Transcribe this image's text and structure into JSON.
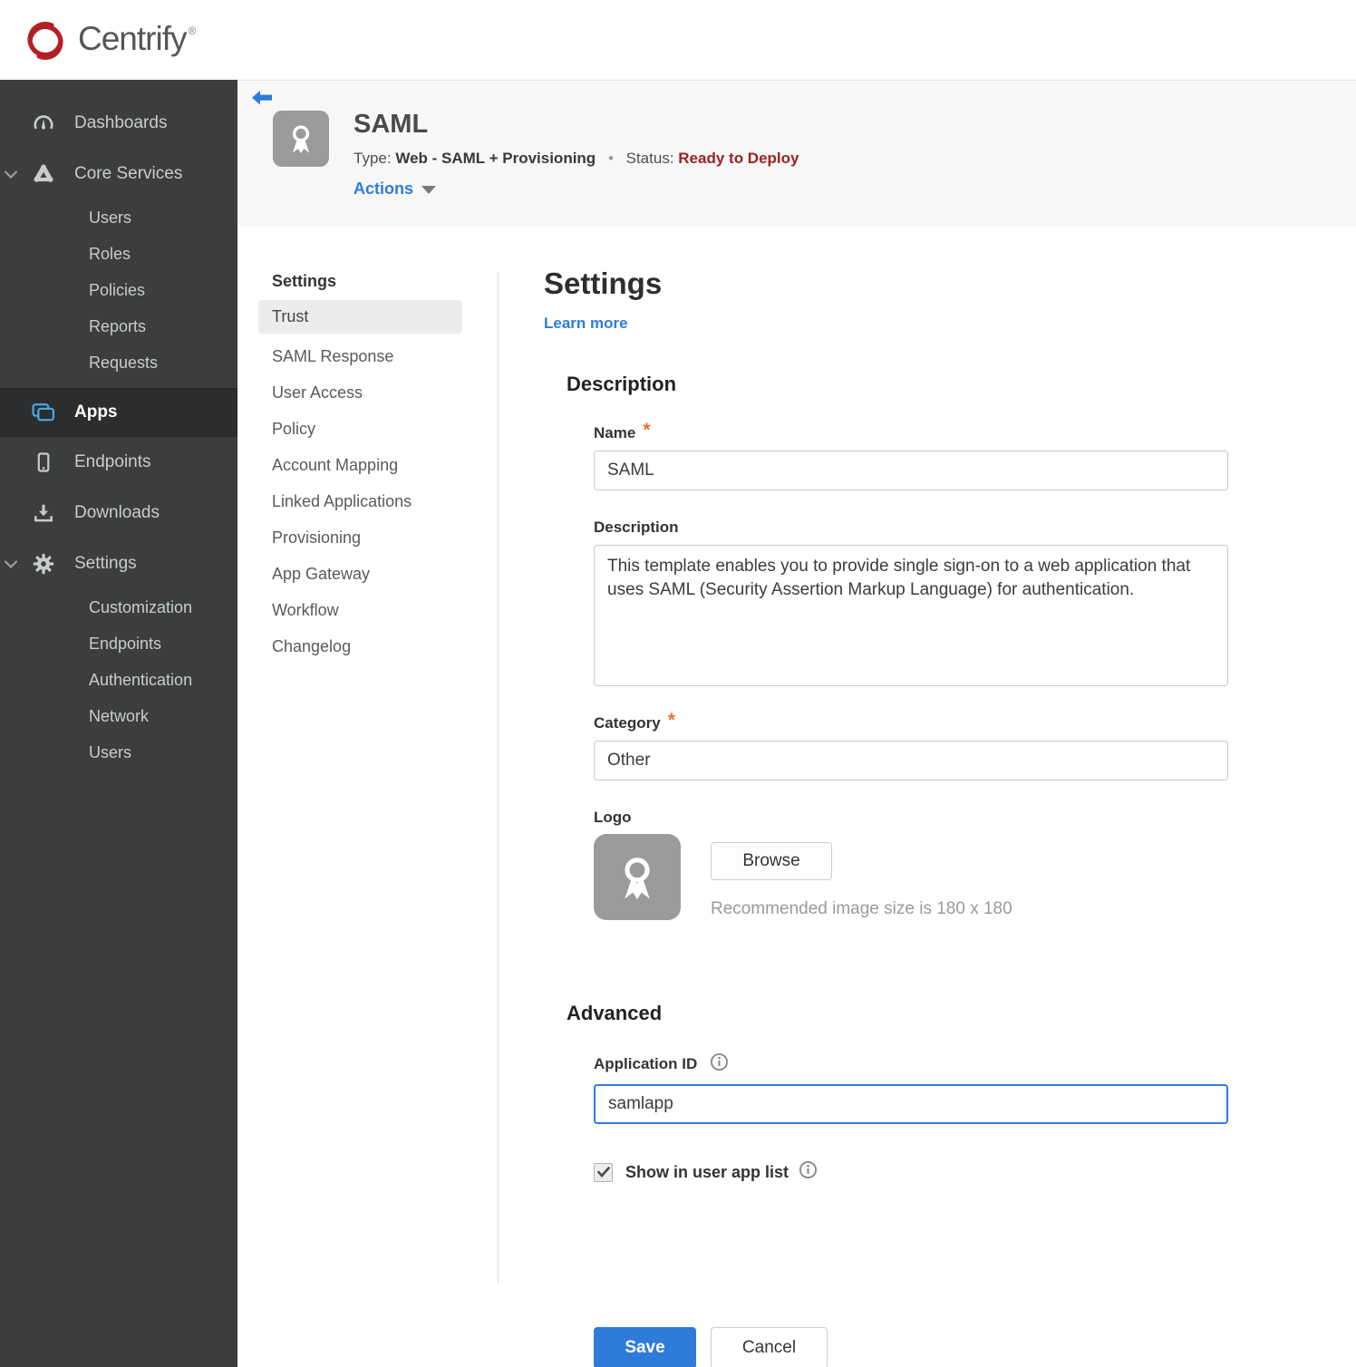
{
  "colors": {
    "accent_blue": "#2f7bda",
    "status_red": "#9e2023",
    "required_orange": "#e8762d",
    "sidebar_icon_blue": "#4aa3e0",
    "brand_red": "#b32025",
    "sidebar_bg": "#3b3d3e"
  },
  "brand": {
    "name": "Centrify",
    "trademark": "®"
  },
  "sidebar": {
    "dashboards": "Dashboards",
    "core_services": "Core Services",
    "core_children": [
      "Users",
      "Roles",
      "Policies",
      "Reports",
      "Requests"
    ],
    "apps": "Apps",
    "endpoints": "Endpoints",
    "downloads": "Downloads",
    "settings": "Settings",
    "settings_children": [
      "Customization",
      "Endpoints",
      "Authentication",
      "Network",
      "Users"
    ]
  },
  "app_header": {
    "title": "SAML",
    "type_label": "Type:",
    "type_value": "Web - SAML + Provisioning",
    "separator": "•",
    "status_label": "Status:",
    "status_value": "Ready to Deploy",
    "actions_label": "Actions"
  },
  "subnav": {
    "title": "Settings",
    "items": [
      {
        "label": "Trust",
        "active": true
      },
      {
        "label": "SAML Response"
      },
      {
        "label": "User Access"
      },
      {
        "label": "Policy"
      },
      {
        "label": "Account Mapping"
      },
      {
        "label": "Linked Applications"
      },
      {
        "label": "Provisioning"
      },
      {
        "label": "App Gateway"
      },
      {
        "label": "Workflow"
      },
      {
        "label": "Changelog"
      }
    ]
  },
  "main": {
    "title": "Settings",
    "learn_more": "Learn more",
    "description": {
      "heading": "Description",
      "name_label": "Name",
      "required_marker": "*",
      "name_value": "SAML",
      "description_label": "Description",
      "description_value": "This template enables you to provide single sign-on to a web application that uses SAML (Security Assertion Markup Language) for authentication.",
      "category_label": "Category",
      "category_value": "Other",
      "logo_label": "Logo",
      "browse_label": "Browse",
      "logo_hint": "Recommended image size is 180 x 180"
    },
    "advanced": {
      "heading": "Advanced",
      "application_id_label": "Application ID",
      "application_id_value": "samlapp",
      "show_in_user_app_list_label": "Show in user app list",
      "checkbox_checked": true
    },
    "footer": {
      "save_label": "Save",
      "cancel_label": "Cancel"
    }
  }
}
